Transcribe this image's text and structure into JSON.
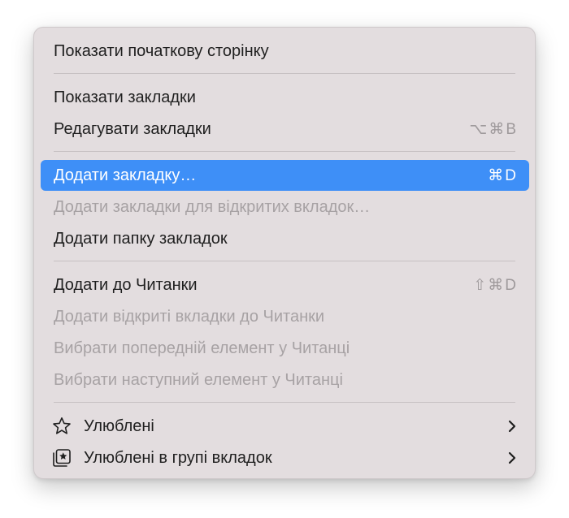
{
  "menu": {
    "items": [
      {
        "label": "Показати початкову сторінку",
        "shortcut": "",
        "state": "enabled"
      },
      {
        "label": "Показати закладки",
        "shortcut": "",
        "state": "enabled"
      },
      {
        "label": "Редагувати закладки",
        "shortcut": "⌥⌘B",
        "state": "enabled"
      },
      {
        "label": "Додати закладку…",
        "shortcut": "⌘D",
        "state": "highlighted"
      },
      {
        "label": "Додати закладки для відкритих вкладок…",
        "shortcut": "",
        "state": "disabled"
      },
      {
        "label": "Додати папку закладок",
        "shortcut": "",
        "state": "enabled"
      },
      {
        "label": "Додати до Читанки",
        "shortcut": "⇧⌘D",
        "state": "enabled"
      },
      {
        "label": "Додати відкриті вкладки до Читанки",
        "shortcut": "",
        "state": "disabled"
      },
      {
        "label": "Вибрати попередній елемент у Читанці",
        "shortcut": "",
        "state": "disabled"
      },
      {
        "label": "Вибрати наступний елемент у Читанці",
        "shortcut": "",
        "state": "disabled"
      },
      {
        "label": "Улюблені",
        "icon": "star-icon",
        "state": "enabled",
        "submenu": true
      },
      {
        "label": "Улюблені в групі вкладок",
        "icon": "tab-group-favorites-icon",
        "state": "enabled",
        "submenu": true
      }
    ]
  },
  "colors": {
    "menu_background": "#e3dddf",
    "highlight": "#3e8ff7",
    "text": "#1f1f1f",
    "disabled_text": "#a7a2a4",
    "shortcut_text": "#9e999b"
  }
}
